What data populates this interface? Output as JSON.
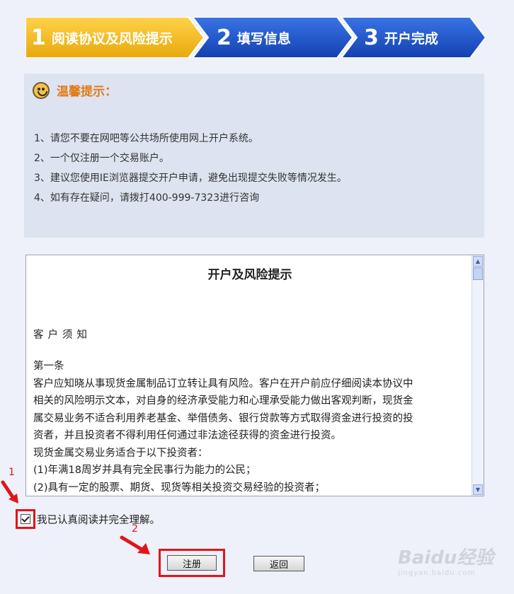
{
  "steps": [
    {
      "num": "1",
      "label": "阅读协议及风险提示"
    },
    {
      "num": "2",
      "label": "填写信息"
    },
    {
      "num": "3",
      "label": "开户完成"
    }
  ],
  "notice": {
    "title": "温馨提示：",
    "items": [
      "1、请您不要在网吧等公共场所使用网上开户系统。",
      "2、一个仅注册一个交易账户。",
      "3、建议您使用IE浏览器提交开户申请，避免出现提交失败等情况发生。",
      "4、如有存在疑问，请拨打400-999-7323进行咨询"
    ]
  },
  "doc": {
    "title": "开户及风险提示",
    "heading": "客户须知",
    "lines": [
      "第一条",
      "客户应知晓从事现货金属制品订立转让具有风险。客户在开户前应仔细阅读本协议中",
      "相关的风险明示文本，对自身的经济承受能力和心理承受能力做出客观判断，现货金",
      "属交易业务不适合利用养老基金、举借债务、银行贷款等方式取得资金进行投资的投",
      "资者，并且投资者不得利用任何通过非法途径获得的资金进行投资。",
      "现货金属交易业务适合于以下投资者：",
      "(1)年满18周岁并具有完全民事行为能力的公民；",
      "(2)具有一定的股票、期货、现货等相关投资交易经验的投资者；"
    ]
  },
  "agree": {
    "label": "我已认真阅读并完全理解。",
    "checked": true
  },
  "buttons": {
    "register": "注册",
    "back": "返回"
  },
  "annotations": {
    "one": "1",
    "two": "2"
  },
  "watermark": {
    "text": "Baidu经验",
    "sub": "jingyan.baidu.com"
  },
  "colors": {
    "step_active": "#f3b91a",
    "step_inactive": "#1e52c8",
    "highlight": "#e2141b",
    "notice_bg": "#dde3f0"
  }
}
